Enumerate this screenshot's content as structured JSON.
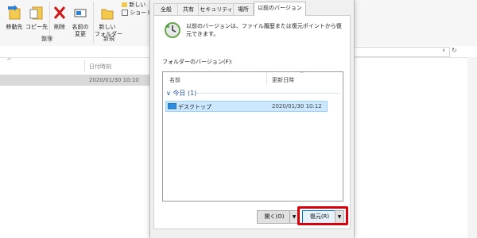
{
  "ribbon": {
    "buttons": [
      {
        "label": "移動先"
      },
      {
        "label": "コピー先"
      },
      {
        "label": "削除"
      },
      {
        "label": "名前の\n変更"
      },
      {
        "label": "新しい\nフォルダー"
      }
    ],
    "small_items": [
      "新しい",
      "ショート"
    ],
    "groups": {
      "organize": "整理",
      "new": "新規"
    }
  },
  "explorer": {
    "date_column": "日付時刻",
    "file_row_date": "2020/01/30 10:10"
  },
  "dialog": {
    "tabs": [
      {
        "label": "全般"
      },
      {
        "label": "共有"
      },
      {
        "label": "セキュリティ"
      },
      {
        "label": "場所"
      },
      {
        "label": "以前のバージョン"
      }
    ],
    "active_tab": "以前のバージョン",
    "description": "以前のバージョンは、ファイル履歴または復元ポイントから復元できます。",
    "folder_versions_label": "フォルダーのバージョン(F):",
    "list": {
      "columns": {
        "name": "名前",
        "date": "更新日時"
      },
      "group": "今日 (1)",
      "rows": [
        {
          "name": "デスクトップ",
          "date": "2020/01/30 10:12"
        }
      ]
    },
    "buttons": {
      "open": "開く(O)",
      "restore": "復元(R)"
    }
  },
  "colors": {
    "highlight": "#d8000b",
    "selection": "#cce8ff",
    "accent": "#0078d7"
  }
}
